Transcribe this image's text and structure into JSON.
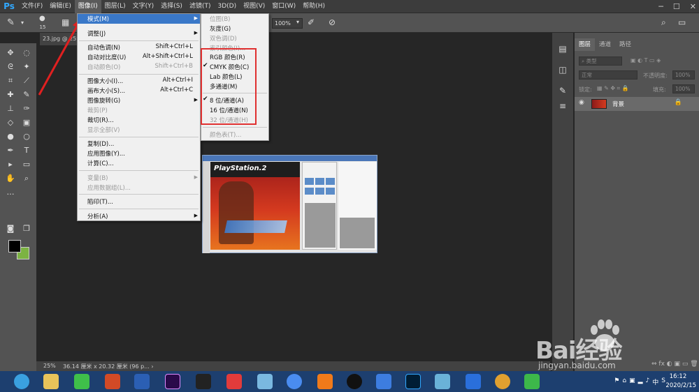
{
  "app": {
    "logo": "Ps"
  },
  "menubar": {
    "items": [
      "文件(F)",
      "编辑(E)",
      "图像(I)",
      "图层(L)",
      "文字(Y)",
      "选择(S)",
      "滤镜(T)",
      "3D(D)",
      "视图(V)",
      "窗口(W)",
      "帮助(H)"
    ],
    "active_index": 2
  },
  "optbar": {
    "brush_size": "15",
    "zoom": "100%"
  },
  "document": {
    "tab": "23.jpg @ 25%"
  },
  "image_menu": {
    "items": [
      {
        "label": "模式(M)",
        "shortcut": "",
        "submenu": true,
        "highlight": true,
        "disabled": false
      },
      {
        "label": "调整(J)",
        "shortcut": "",
        "submenu": true,
        "disabled": false
      },
      {
        "label": "自动色调(N)",
        "shortcut": "Shift+Ctrl+L",
        "disabled": false
      },
      {
        "label": "自动对比度(U)",
        "shortcut": "Alt+Shift+Ctrl+L",
        "disabled": false
      },
      {
        "label": "自动颜色(O)",
        "shortcut": "Shift+Ctrl+B",
        "disabled": true
      },
      {
        "label": "图像大小(I)...",
        "shortcut": "Alt+Ctrl+I",
        "disabled": false
      },
      {
        "label": "画布大小(S)...",
        "shortcut": "Alt+Ctrl+C",
        "disabled": false
      },
      {
        "label": "图像旋转(G)",
        "shortcut": "",
        "submenu": true,
        "disabled": false
      },
      {
        "label": "裁剪(P)",
        "shortcut": "",
        "disabled": true
      },
      {
        "label": "裁切(R)...",
        "shortcut": "",
        "disabled": false
      },
      {
        "label": "显示全部(V)",
        "shortcut": "",
        "disabled": true
      },
      {
        "label": "复制(D)...",
        "shortcut": "",
        "disabled": false
      },
      {
        "label": "应用图像(Y)...",
        "shortcut": "",
        "disabled": false
      },
      {
        "label": "计算(C)...",
        "shortcut": "",
        "disabled": false
      },
      {
        "label": "变量(B)",
        "shortcut": "",
        "submenu": true,
        "disabled": true
      },
      {
        "label": "应用数据组(L)...",
        "shortcut": "",
        "disabled": true
      },
      {
        "label": "陷印(T)...",
        "shortcut": "",
        "disabled": false
      },
      {
        "label": "分析(A)",
        "shortcut": "",
        "submenu": true,
        "disabled": false
      }
    ]
  },
  "mode_menu": {
    "items": [
      {
        "label": "位图(B)",
        "disabled": true,
        "checked": false
      },
      {
        "label": "灰度(G)",
        "disabled": false,
        "checked": false
      },
      {
        "label": "双色调(D)",
        "disabled": true,
        "checked": false
      },
      {
        "label": "索引颜色(I)...",
        "disabled": true,
        "checked": false
      },
      {
        "label": "RGB 颜色(R)",
        "disabled": false,
        "checked": false
      },
      {
        "label": "CMYK 颜色(C)",
        "disabled": false,
        "checked": true
      },
      {
        "label": "Lab 颜色(L)",
        "disabled": false,
        "checked": false
      },
      {
        "label": "多通道(M)",
        "disabled": false,
        "checked": false
      },
      {
        "label": "8 位/通道(A)",
        "disabled": false,
        "checked": true
      },
      {
        "label": "16 位/通道(N)",
        "disabled": false,
        "checked": false
      },
      {
        "label": "32 位/通道(H)",
        "disabled": true,
        "checked": false
      },
      {
        "label": "颜色表(T)...",
        "disabled": true,
        "checked": false
      }
    ]
  },
  "canvas_image": {
    "title": "PlayStation.2"
  },
  "layers_panel": {
    "tabs": [
      "图层",
      "通道",
      "路径"
    ],
    "filter_label": "类型",
    "blend_mode": "正常",
    "opacity_label": "不透明度:",
    "opacity": "100%",
    "lock_label": "锁定:",
    "fill_label": "填充:",
    "fill": "100%",
    "layer_name": "背景"
  },
  "statusbar": {
    "zoom": "25%",
    "doc_info": "36.14 厘米 x 20.32 厘米 (96 p... ›"
  },
  "taskbar": {
    "time": "16:12",
    "date": "2020/2/15"
  },
  "watermark": {
    "text": "Bai经验",
    "url": "jingyan.baidu.com"
  },
  "colors": {
    "accent": "#3a78c8",
    "ps_blue": "#31a8ff",
    "highlight_box": "#e03030",
    "bg_swatch": "#7cb342"
  }
}
